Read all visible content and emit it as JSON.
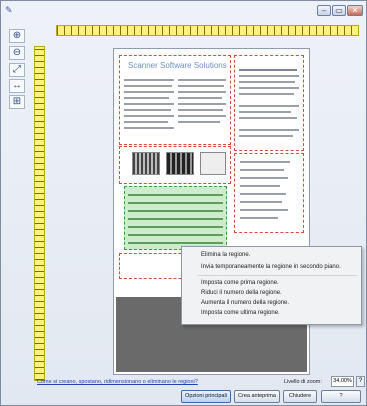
{
  "window": {
    "title_icon_glyph": "✎",
    "controls": [
      "–",
      "▭",
      "✕"
    ]
  },
  "toolbar": {
    "tools": [
      {
        "name": "zoom-in-icon",
        "glyph": "⊕"
      },
      {
        "name": "zoom-out-icon",
        "glyph": "⊖"
      },
      {
        "name": "fit-page-icon",
        "glyph": "⤢"
      },
      {
        "name": "fit-width-icon",
        "glyph": "↔"
      },
      {
        "name": "add-region-icon",
        "glyph": "⊞"
      }
    ]
  },
  "preview": {
    "document_title": "Scanner Software Solutions"
  },
  "context_menu": {
    "items": [
      "Elimina la regione.",
      "Invia temporaneamente la regione in secondo piano.",
      "Imposta come prima regione.",
      "Riduci il numero della regione.",
      "Aumenta il numero della regione.",
      "Imposta come ultima regione."
    ]
  },
  "footer": {
    "help_link": "Come si creano, spostano, ridimensionano o eliminano le regioni?",
    "zoom_label": "Livello di zoom:",
    "zoom_value": "34,00%",
    "zoom_help": "?"
  },
  "buttons": {
    "main_options": "Opzioni principali",
    "preview": "Crea anteprima",
    "close": "Chiudere",
    "help": "?"
  }
}
